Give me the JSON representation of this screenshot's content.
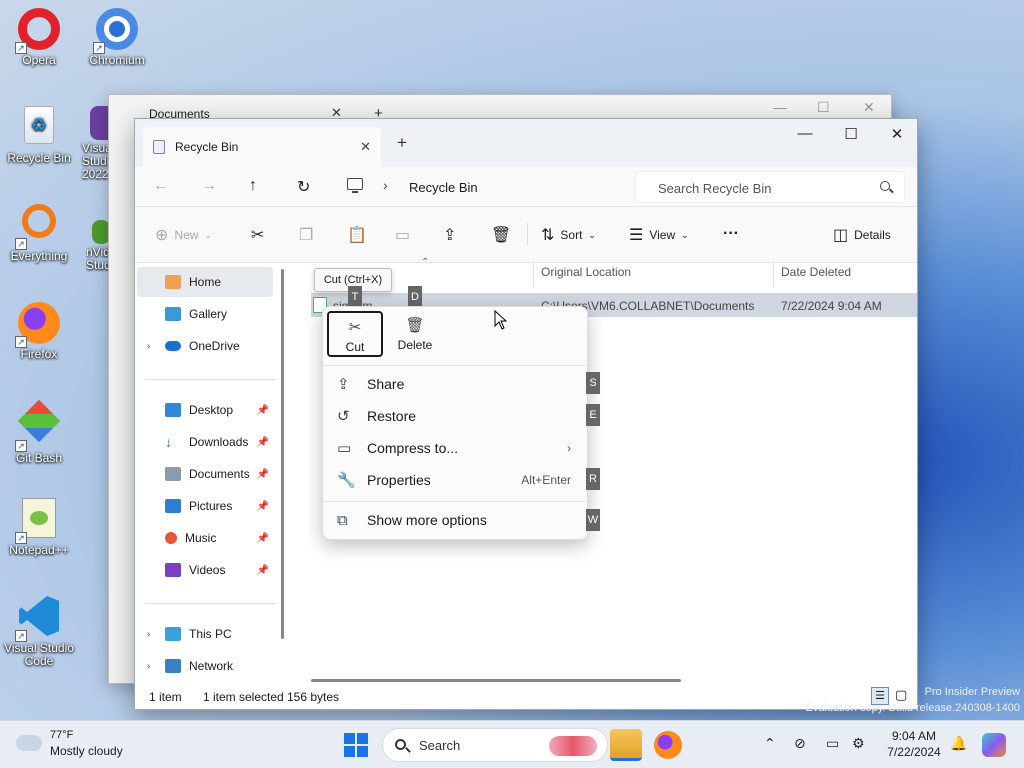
{
  "desktop": {
    "icons": [
      "Opera",
      "Chromium",
      "Recycle Bin",
      "Visual Studio 2022",
      "Everything",
      "nVidia Studio",
      "Firefox",
      "Git Bash",
      "Notepad++",
      "Visual Studio Code"
    ]
  },
  "background_window": {
    "tab_title": "Documents"
  },
  "window": {
    "tab_title": "Recycle Bin",
    "address": {
      "crumb": "Recycle Bin",
      "search_placeholder": "Search Recycle Bin"
    },
    "commands": {
      "new": "New",
      "sort": "Sort",
      "view": "View",
      "more": "···",
      "details": "Details"
    },
    "nav": {
      "items": [
        {
          "label": "Home"
        },
        {
          "label": "Gallery"
        },
        {
          "label": "OneDrive"
        },
        {
          "label": "Desktop"
        },
        {
          "label": "Downloads"
        },
        {
          "label": "Documents"
        },
        {
          "label": "Pictures"
        },
        {
          "label": "Music"
        },
        {
          "label": "Videos"
        },
        {
          "label": "This PC"
        },
        {
          "label": "Network"
        }
      ]
    },
    "columns": {
      "original_location": "Original Location",
      "date_deleted": "Date Deleted"
    },
    "row": {
      "name": "sig.rpm",
      "location": "C:\\Users\\VM6.COLLABNET\\Documents",
      "date": "7/22/2024 9:04 AM"
    },
    "status": {
      "count": "1 item",
      "selected": "1 item selected",
      "size": "156 bytes"
    }
  },
  "tooltip": "Cut (Ctrl+X)",
  "keytips": {
    "cut": "T",
    "delete": "D",
    "share": "S",
    "restore": "E",
    "properties": "R",
    "more": "W"
  },
  "context_menu": {
    "cut": "Cut",
    "delete": "Delete",
    "share": "Share",
    "restore": "Restore",
    "compress": "Compress to...",
    "properties": "Properties",
    "properties_accel": "Alt+Enter",
    "more_options": "Show more options"
  },
  "taskbar": {
    "temp": "77°F",
    "weather": "Mostly cloudy",
    "search_placeholder": "Search",
    "time": "9:04 AM",
    "date": "7/22/2024"
  },
  "watermark": {
    "line1": "Pro Insider Preview",
    "line2": "Evaluation copy. Build release.240308-1400"
  }
}
